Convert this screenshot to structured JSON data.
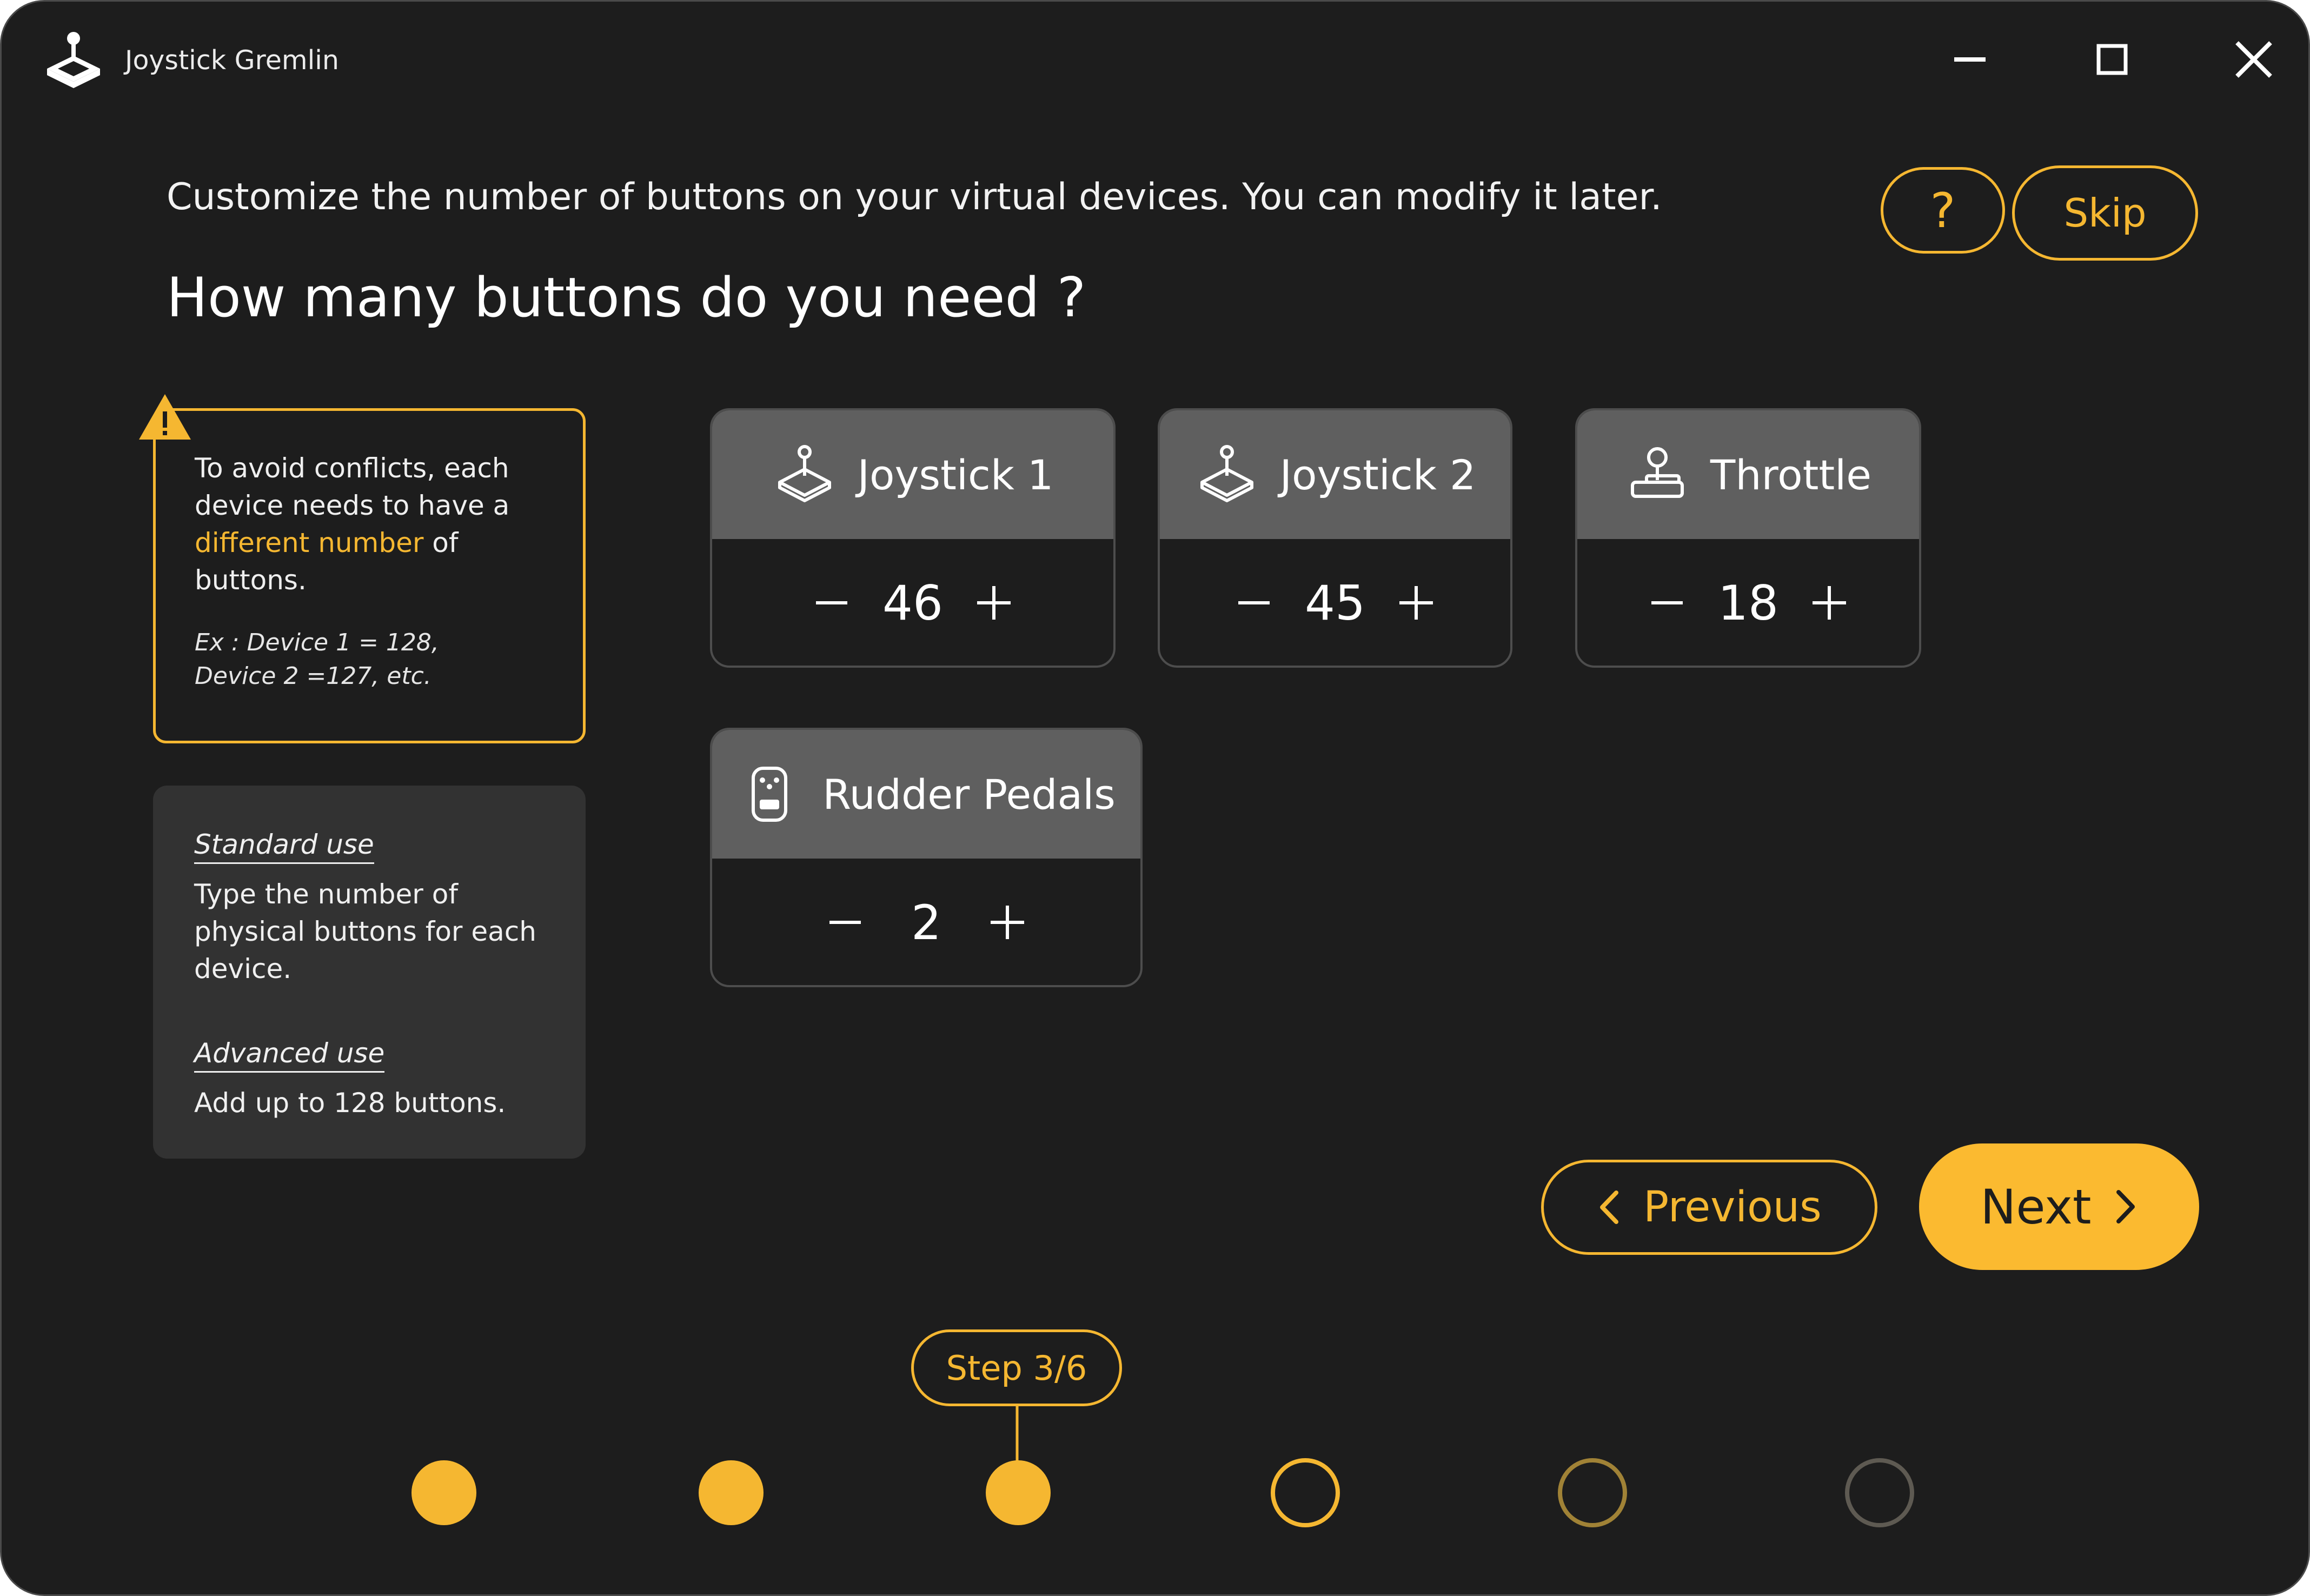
{
  "app": {
    "title": "Joystick Gremlin",
    "logo_icon": "joystick-logo-icon",
    "window_controls": [
      "minimize-icon",
      "maximize-icon",
      "close-icon"
    ]
  },
  "header": {
    "subtitle": "Customize the number of buttons on your virtual devices. You can modify it later.",
    "title": "How many buttons do you need ?",
    "help_label": "?",
    "skip_label": "Skip"
  },
  "warning": {
    "icon": "warning-icon",
    "text_before": "To avoid conflicts, each device needs to have a ",
    "highlight": "different number",
    "text_after": " of buttons.",
    "example_line1": "Ex : Device 1 = 128,",
    "example_line2": "Device 2 =127, etc."
  },
  "info": {
    "standard_heading": "Standard use",
    "standard_body": "Type the number of physical buttons for each device.",
    "advanced_heading": "Advanced use",
    "advanced_body": "Add up to 128 buttons."
  },
  "devices": [
    {
      "name": "Joystick 1",
      "value": "46",
      "icon": "joystick-icon"
    },
    {
      "name": "Joystick 2",
      "value": "45",
      "icon": "joystick-icon"
    },
    {
      "name": "Throttle",
      "value": "18",
      "icon": "throttle-icon"
    },
    {
      "name": "Rudder Pedals",
      "value": "2",
      "icon": "rudder-pedals-icon"
    }
  ],
  "stepper": {
    "decrement_icon": "minus-icon",
    "increment_icon": "plus-icon"
  },
  "navigation": {
    "previous_label": "Previous",
    "next_label": "Next"
  },
  "progress": {
    "step_label": "Step 3/6",
    "current_step": 3,
    "total_steps": 6,
    "accent_color": "#f5b731"
  }
}
